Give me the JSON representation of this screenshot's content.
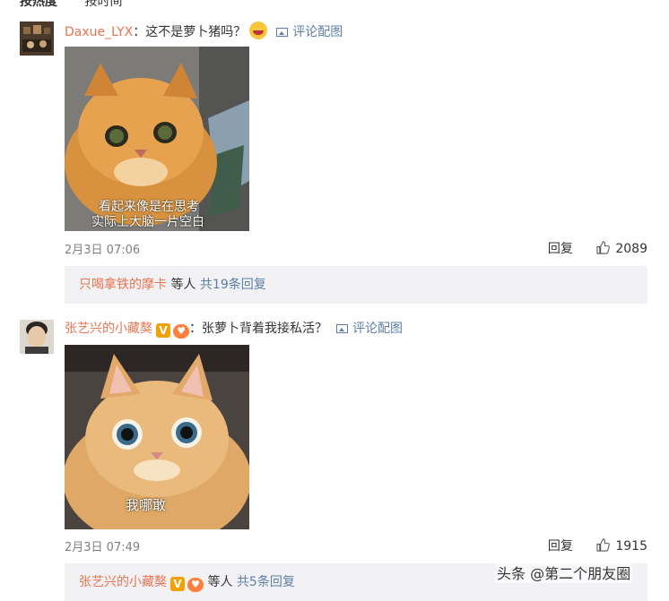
{
  "sort": {
    "hot": "按热度",
    "time": "按时间"
  },
  "comments": [
    {
      "user": "Daxue_LYX",
      "text": "：这不是萝卜猪吗？",
      "pic_label": "评论配图",
      "image_caption_1": "看起来像是在思考",
      "image_caption_2": "实际上大脑一片空白",
      "date": "2月3日 07:06",
      "reply_label": "回复",
      "likes": "2089",
      "replies_user": "只喝拿铁的摩卡",
      "replies_mid": " 等人 ",
      "replies_more": "共19条回复"
    },
    {
      "user": "张艺兴的小藏獒",
      "badge_v": "V",
      "text": "：张萝卜背着我接私活？",
      "pic_label": "评论配图",
      "image_caption_1": "我哪敢",
      "date": "2月3日 07:49",
      "reply_label": "回复",
      "likes": "1915",
      "replies_user": "张艺兴的小藏獒",
      "replies_mid": " 等人 ",
      "replies_more": "共5条回复"
    }
  ],
  "watermark": "头条 @第二个朋友圈",
  "colors": {
    "username": "#eb7350",
    "link": "#5d7ea8",
    "reply_bg": "#f2f2f5",
    "date": "#808080"
  }
}
